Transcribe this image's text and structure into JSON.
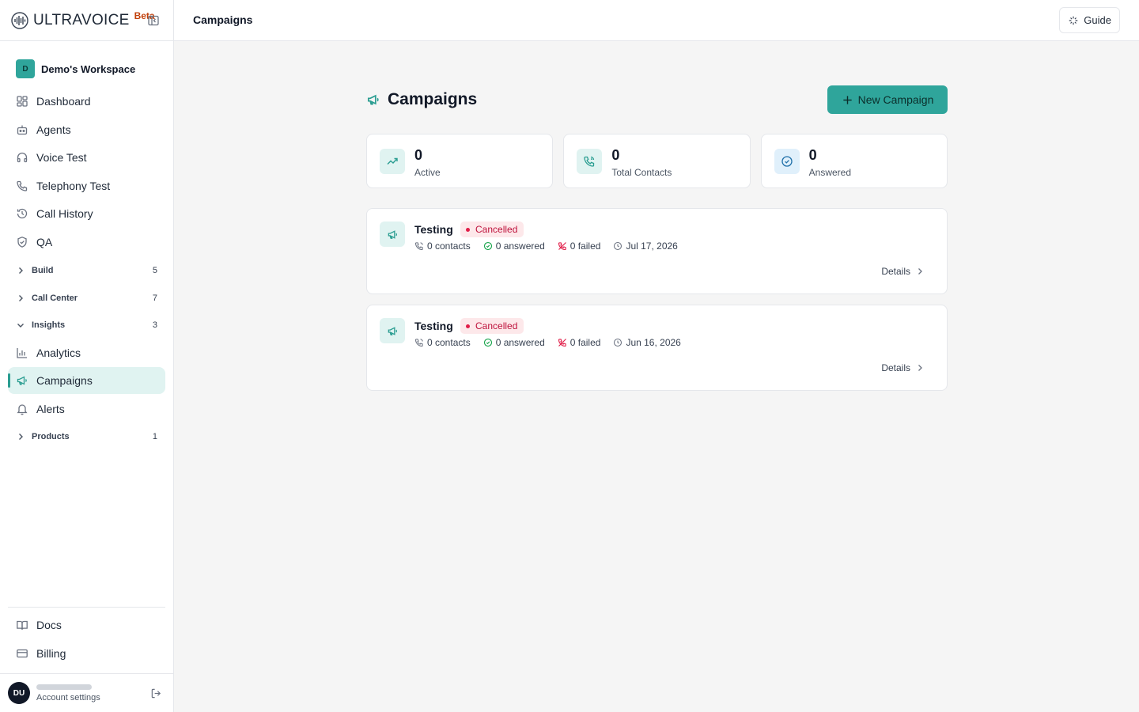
{
  "app": {
    "name": "ULTRAVOICE",
    "beta": "Beta"
  },
  "workspace": {
    "initial": "D",
    "name": "Demo's Workspace"
  },
  "nav": {
    "dashboard": "Dashboard",
    "agents": "Agents",
    "voice_test": "Voice Test",
    "telephony_test": "Telephony Test",
    "call_history": "Call History",
    "qa": "QA",
    "build": {
      "label": "Build",
      "count": "5"
    },
    "call_center": {
      "label": "Call Center",
      "count": "7"
    },
    "insights": {
      "label": "Insights",
      "count": "3"
    },
    "analytics": "Analytics",
    "campaigns": "Campaigns",
    "alerts": "Alerts",
    "products": {
      "label": "Products",
      "count": "1"
    },
    "docs": "Docs",
    "billing": "Billing"
  },
  "account": {
    "initials": "DU",
    "label": "Account settings"
  },
  "header": {
    "title": "Campaigns",
    "guide": "Guide"
  },
  "page": {
    "title": "Campaigns",
    "new_button": "New Campaign"
  },
  "stats": [
    {
      "value": "0",
      "label": "Active"
    },
    {
      "value": "0",
      "label": "Total Contacts"
    },
    {
      "value": "0",
      "label": "Answered"
    }
  ],
  "campaigns": [
    {
      "name": "Testing",
      "status": "Cancelled",
      "contacts": "0 contacts",
      "answered": "0 answered",
      "failed": "0 failed",
      "date": "Jul 17, 2026",
      "details": "Details"
    },
    {
      "name": "Testing",
      "status": "Cancelled",
      "contacts": "0 contacts",
      "answered": "0 answered",
      "failed": "0 failed",
      "date": "Jun 16, 2026",
      "details": "Details"
    }
  ],
  "colors": {
    "accent": "#2fa59b",
    "accent_light": "#e0f3f1",
    "danger": "#e11d48",
    "danger_bg": "#fde8ea"
  }
}
